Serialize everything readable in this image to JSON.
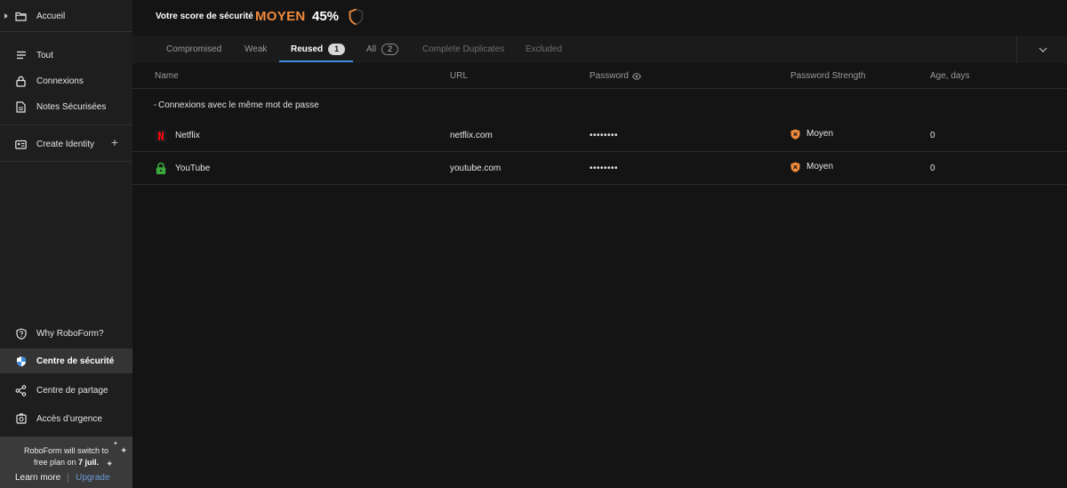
{
  "sidebar": {
    "home": "Accueil",
    "items": [
      {
        "label": "Tout",
        "icon": "list-icon"
      },
      {
        "label": "Connexions",
        "icon": "lock-icon"
      },
      {
        "label": "Notes Sécurisées",
        "icon": "note-icon"
      }
    ],
    "identity": {
      "label": "Create Identity",
      "plus": "+"
    },
    "bottom_items": [
      {
        "label": "Why RoboForm?",
        "icon": "shield-question-icon"
      },
      {
        "label": "Centre de sécurité",
        "icon": "security-shield-icon"
      },
      {
        "label": "Centre de partage",
        "icon": "share-icon"
      },
      {
        "label": "Accès d’urgence",
        "icon": "emergency-icon"
      }
    ],
    "promo": {
      "line1": "RoboForm will switch to",
      "line2_prefix": "free plan on ",
      "line2_date": "7 juil.",
      "learn_more": "Learn more",
      "upgrade": "Upgrade"
    }
  },
  "header": {
    "score_label": "Votre score de sécurité",
    "score_level": "MOYEN",
    "score_percent": "45%",
    "score_value": 0.45
  },
  "tabs": [
    {
      "label": "Compromised",
      "badge": ""
    },
    {
      "label": "Weak",
      "badge": ""
    },
    {
      "label": "Reused",
      "badge": "1"
    },
    {
      "label": "All",
      "badge": "2"
    },
    {
      "label": "Complete Duplicates",
      "badge": ""
    },
    {
      "label": "Excluded",
      "badge": ""
    }
  ],
  "table": {
    "columns": {
      "name": "Name",
      "url": "URL",
      "password": "Password",
      "strength": "Password Strength",
      "age": "Age, days"
    },
    "group_label": "Connexions avec le même mot de passe",
    "rows": [
      {
        "name": "Netflix",
        "icon": "netflix-icon",
        "url": "netflix.com",
        "password": "••••••••",
        "strength": "Moyen",
        "age": "0"
      },
      {
        "name": "YouTube",
        "icon": "lock-green-icon",
        "url": "youtube.com",
        "password": "••••••••",
        "strength": "Moyen",
        "age": "0"
      }
    ]
  },
  "colors": {
    "accent_blue": "#3a8de0",
    "score_orange": "#f08a3c",
    "strength_orange": "#f08a3c",
    "netflix_red": "#e50914",
    "lock_green": "#3aa83a"
  }
}
